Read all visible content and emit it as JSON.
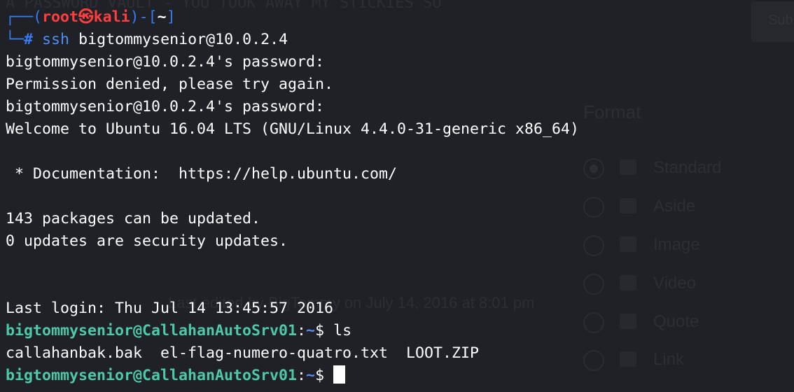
{
  "background_page": {
    "header_text": "A PASSWORD VAULT - YOU TOOK AWAY MY STICKIES SO",
    "submit_button": "Sub",
    "format_heading": "Format",
    "format_options": [
      "Standard",
      "Aside",
      "Image",
      "Video",
      "Quote",
      "Link"
    ],
    "last_edited": "Last edited by BigTommy on July 14, 2016 at 8:01 pm"
  },
  "prompt": {
    "user": "root",
    "at_symbol": "㉿",
    "host": "kali",
    "cwd": "~",
    "hash": "#",
    "command_word": "ssh",
    "command_args": " bigtommysenior@10.0.2.4"
  },
  "output": [
    "bigtommysenior@10.0.2.4's password:",
    "Permission denied, please try again.",
    "bigtommysenior@10.0.2.4's password:",
    "Welcome to Ubuntu 16.04 LTS (GNU/Linux 4.4.0-31-generic x86_64)",
    "",
    " * Documentation:  https://help.ubuntu.com/",
    "",
    "143 packages can be updated.",
    "0 updates are security updates.",
    "",
    "",
    "Last login: Thu Jul 14 13:45:57 2016"
  ],
  "remote_prompt": {
    "user_host": "bigtommysenior@CallahanAutoSrv01",
    "path": "~",
    "dollar": "$",
    "command": " ls"
  },
  "ls_output": "callahanbak.bak  el-flag-numero-quatro.txt  LOOT.ZIP",
  "colors": {
    "background": "#1f2127",
    "prompt_frame": "#367bf0",
    "root_red": "#ff3f3f",
    "remote_user_green": "#4ec9a8",
    "path_blue": "#4f8ef7",
    "text": "#ffffff"
  }
}
